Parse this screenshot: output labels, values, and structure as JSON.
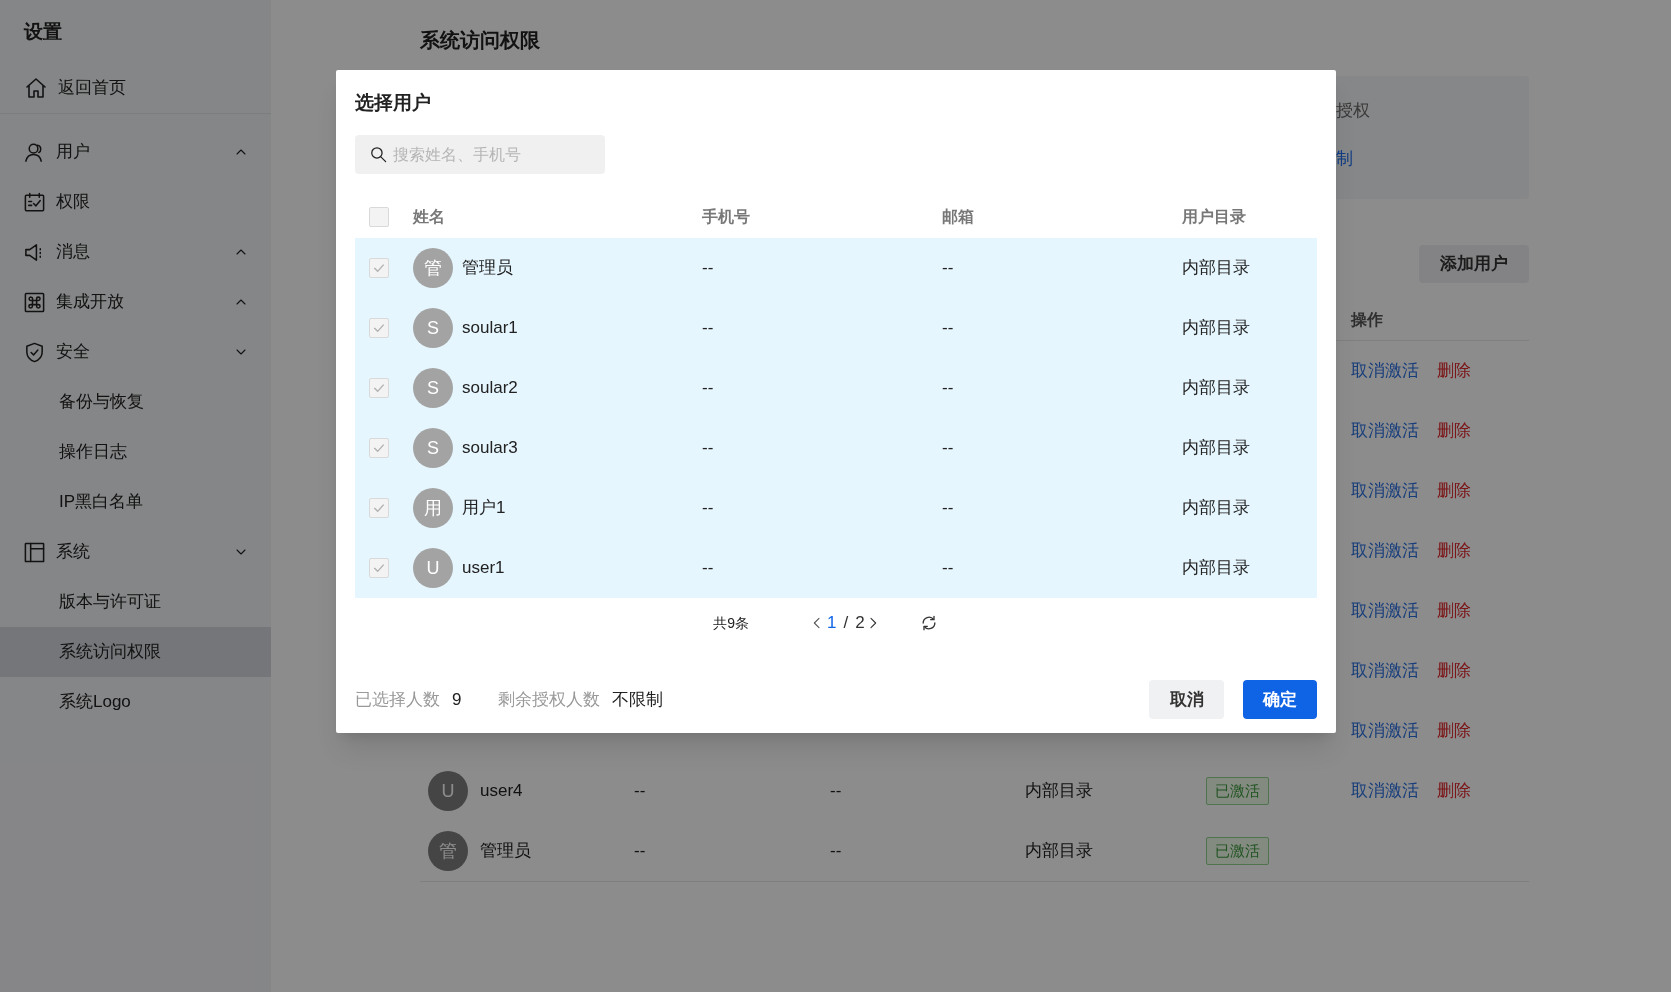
{
  "sidebar": {
    "title": "设置",
    "home_link": "返回首页",
    "items": [
      {
        "label": "用户",
        "expanded": false,
        "selected": false
      },
      {
        "label": "权限",
        "selected": false
      },
      {
        "label": "消息",
        "expanded": false,
        "selected": false
      },
      {
        "label": "集成开放",
        "expanded": false,
        "selected": false
      },
      {
        "label": "安全",
        "expanded": true,
        "selected": false,
        "children": [
          {
            "label": "备份与恢复",
            "selected": false
          },
          {
            "label": "操作日志",
            "selected": false
          },
          {
            "label": "IP黑白名单",
            "selected": false
          }
        ]
      },
      {
        "label": "系统",
        "expanded": true,
        "selected": false,
        "children": [
          {
            "label": "版本与许可证",
            "selected": false
          },
          {
            "label": "系统访问权限",
            "selected": true
          },
          {
            "label": "系统Logo",
            "selected": false
          }
        ]
      }
    ]
  },
  "page": {
    "title": "系统访问权限",
    "license_card": {
      "label_fragment": "授权",
      "value_fragment": "制"
    },
    "add_user_button": "添加用户",
    "table": {
      "columns": [
        "操作"
      ],
      "rows": [
        {
          "actions": [
            "取消激活",
            "删除"
          ]
        },
        {
          "actions": [
            "取消激活",
            "删除"
          ]
        },
        {
          "actions": [
            "取消激活",
            "删除"
          ]
        },
        {
          "actions": [
            "取消激活",
            "删除"
          ]
        },
        {
          "actions": [
            "取消激活",
            "删除"
          ]
        },
        {
          "actions": [
            "取消激活",
            "删除"
          ]
        },
        {
          "actions": [
            "取消激活",
            "删除"
          ]
        },
        {
          "avatar": "U",
          "name": "user4",
          "phone": "--",
          "email": "--",
          "directory": "内部目录",
          "status": "已激活",
          "actions": [
            "取消激活",
            "删除"
          ]
        },
        {
          "avatar": "管",
          "name": "管理员",
          "phone": "--",
          "email": "--",
          "directory": "内部目录",
          "status": "已激活"
        }
      ]
    }
  },
  "dialog": {
    "title": "选择用户",
    "search": {
      "placeholder": "搜索姓名、手机号"
    },
    "table": {
      "select_all": {
        "checked": false,
        "disabled": true
      },
      "columns": [
        "姓名",
        "手机号",
        "邮箱",
        "用户目录"
      ],
      "rows": [
        {
          "avatar": "管",
          "name": "管理员",
          "phone": "--",
          "email": "--",
          "directory": "内部目录",
          "checked": true,
          "disabled": true
        },
        {
          "avatar": "S",
          "name": "soular1",
          "phone": "--",
          "email": "--",
          "directory": "内部目录",
          "checked": true,
          "disabled": true
        },
        {
          "avatar": "S",
          "name": "soular2",
          "phone": "--",
          "email": "--",
          "directory": "内部目录",
          "checked": true,
          "disabled": true
        },
        {
          "avatar": "S",
          "name": "soular3",
          "phone": "--",
          "email": "--",
          "directory": "内部目录",
          "checked": true,
          "disabled": true
        },
        {
          "avatar": "用",
          "name": "用户1",
          "phone": "--",
          "email": "--",
          "directory": "内部目录",
          "checked": true,
          "disabled": true
        },
        {
          "avatar": "U",
          "name": "user1",
          "phone": "--",
          "email": "--",
          "directory": "内部目录",
          "checked": true,
          "disabled": true
        }
      ]
    },
    "pagination": {
      "total": "共9条",
      "current": "1",
      "separator": "/",
      "pages": "2"
    },
    "footer": {
      "selected_label": "已选择人数",
      "selected_value": "9",
      "remaining_label": "剩余授权人数",
      "remaining_value": "不限制"
    },
    "buttons": {
      "cancel": "取消",
      "confirm": "确定"
    }
  }
}
